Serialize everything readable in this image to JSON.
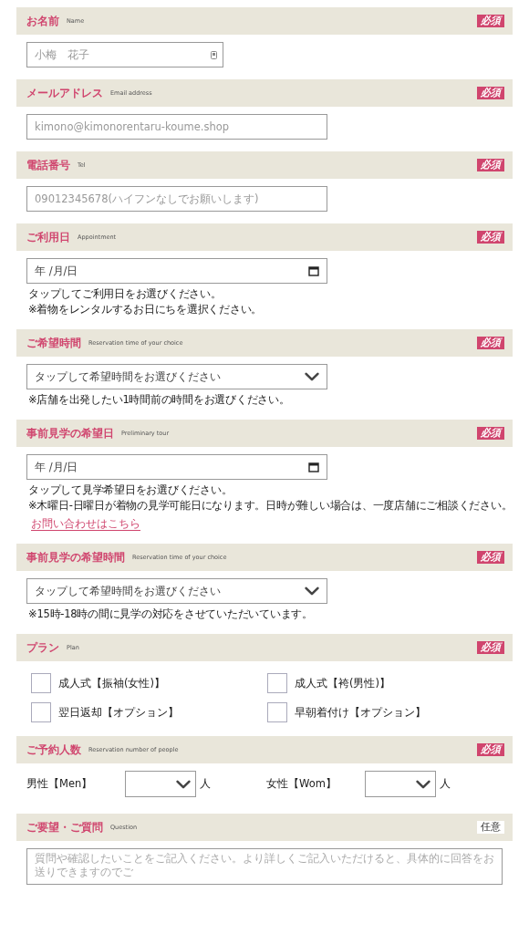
{
  "sections": [
    {
      "kind": "text",
      "title": "お名前",
      "subtitle": "Name",
      "badge": {
        "text": "必須",
        "kind": "required"
      },
      "field": {
        "kind": "name",
        "placeholder": "小梅　花子"
      }
    },
    {
      "kind": "text",
      "title": "メールアドレス",
      "subtitle": "Email address",
      "badge": {
        "text": "必須",
        "kind": "required"
      },
      "field": {
        "kind": "email",
        "placeholder": "kimono@kimonorentaru-koume.shop"
      }
    },
    {
      "kind": "text",
      "title": "電話番号",
      "subtitle": "Tel",
      "badge": {
        "text": "必須",
        "kind": "required"
      },
      "field": {
        "kind": "tel",
        "placeholder": "09012345678(ハイフンなしでお願いします)"
      }
    },
    {
      "kind": "date",
      "title": "ご利用日",
      "subtitle": "Appointment",
      "badge": {
        "text": "必須",
        "kind": "required"
      },
      "field": {
        "value": "年 /月/日"
      },
      "notes": [
        {
          "kind": "note",
          "text": "タップしてご利用日をお選びください。"
        },
        {
          "kind": "note",
          "text": "※着物をレンタルするお日にちを選択ください。"
        }
      ]
    },
    {
      "kind": "select",
      "title": "ご希望時間",
      "subtitle": "Reservation time of your choice",
      "badge": {
        "text": "必須",
        "kind": "required"
      },
      "field": {
        "value": "タップして希望時間をお選びください"
      },
      "notes": [
        {
          "kind": "note",
          "text": "※店舗を出発したい1時間前の時間をお選びください。"
        }
      ]
    },
    {
      "kind": "date",
      "title": "事前見学の希望日",
      "subtitle": "Preliminary tour",
      "badge": {
        "text": "必須",
        "kind": "required"
      },
      "field": {
        "value": "年 /月/日"
      },
      "notes": [
        {
          "kind": "note",
          "text": "タップして見学希望日をお選びください。"
        },
        {
          "kind": "note",
          "text": "※木曜日-日曜日が着物の見学可能日になります。日時が難しい場合は、一度店舗にご相談ください。"
        },
        {
          "kind": "link",
          "text": "お問い合わせはこちら"
        }
      ]
    },
    {
      "kind": "select",
      "title": "事前見学の希望時間",
      "subtitle": "Reservation time of your choice",
      "badge": {
        "text": "必須",
        "kind": "required"
      },
      "field": {
        "value": "タップして希望時間をお選びください"
      },
      "notes": [
        {
          "kind": "note",
          "text": "※15時-18時の間に見学の対応をさせていただいています。"
        }
      ]
    },
    {
      "kind": "checkboxes",
      "title": "プラン",
      "subtitle": "Plan",
      "badge": {
        "text": "必須",
        "kind": "required"
      },
      "options": [
        {
          "label": "成人式【振袖(女性)】",
          "checked": false
        },
        {
          "label": "成人式【袴(男性)】",
          "checked": false
        },
        {
          "label": "翌日返却【オプション】",
          "checked": false
        },
        {
          "label": "早朝着付け【オプション】",
          "checked": false
        }
      ]
    },
    {
      "kind": "people",
      "title": "ご予約人数",
      "subtitle": "Reservation number of people",
      "badge": {
        "text": "必須",
        "kind": "required"
      },
      "groups": [
        {
          "label": "男性【Men】",
          "unit": "人"
        },
        {
          "label": "女性【Wom】",
          "unit": "人"
        }
      ]
    },
    {
      "kind": "textarea",
      "title": "ご要望・ご質問",
      "subtitle": "Question",
      "badge": {
        "text": "任意",
        "kind": "optional"
      },
      "field": {
        "placeholder": "質問や確認したいことをご記入ください。より詳しくご記入いただけると、具体的に回答をお送りできますのでご"
      }
    }
  ]
}
